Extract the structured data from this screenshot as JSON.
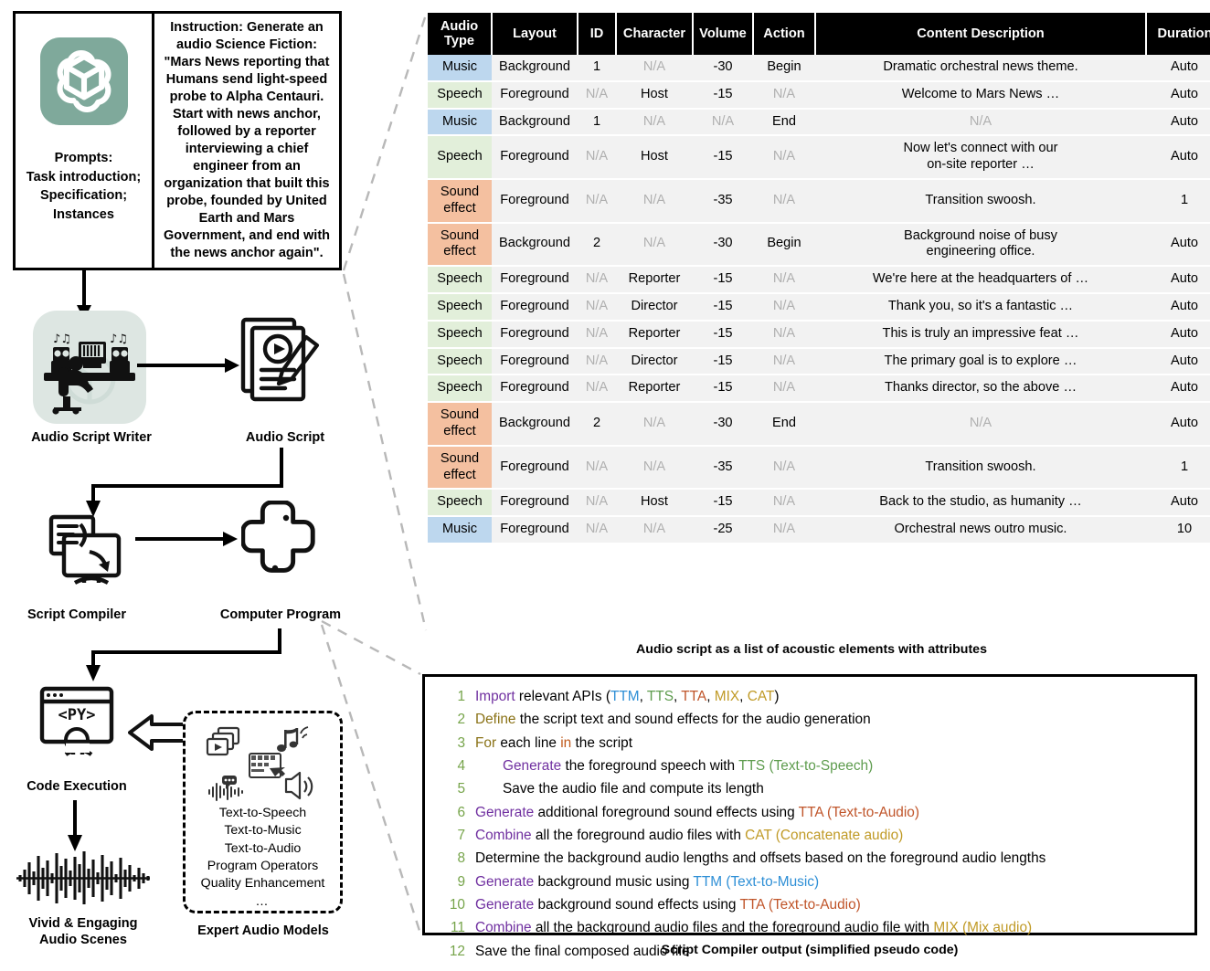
{
  "pipeline": {
    "prompts_label": "Prompts:\nTask introduction;\nSpecification;\nInstances",
    "instruction_text": "Instruction: Generate an audio Science Fiction: \"Mars News reporting that Humans send light-speed probe to Alpha Centauri. Start with news anchor, followed by a reporter interviewing a chief engineer from an organization that built this probe, founded by United Earth and Mars Government, and end with the news anchor again\".",
    "nodes": {
      "audio_script_writer": "Audio Script Writer",
      "audio_script": "Audio Script",
      "script_compiler": "Script Compiler",
      "computer_program": "Computer Program",
      "code_execution": "Code Execution",
      "vivid_scenes": "Vivid & Engaging\nAudio Scenes",
      "expert_audio_models": "Expert Audio Models"
    },
    "expert_models": [
      "Text-to-Speech",
      "Text-to-Music",
      "Text-to-Audio",
      "Program Operators",
      "Quality Enhancement",
      "…"
    ]
  },
  "table": {
    "caption": "Audio script as a list of  acoustic elements with attributes",
    "headers": [
      "Audio\nType",
      "Layout",
      "ID",
      "Character",
      "Volume",
      "Action",
      "Content Description",
      "Duration"
    ],
    "type_colors": {
      "Music": "#bdd7ee",
      "Speech": "#e2efda",
      "Sound effect": "#f4c0a0"
    },
    "rows": [
      {
        "type": "Music",
        "layout": "Background",
        "id": "1",
        "character": "N/A",
        "volume": "-30",
        "action": "Begin",
        "content": "Dramatic orchestral news theme.",
        "duration": "Auto"
      },
      {
        "type": "Speech",
        "layout": "Foreground",
        "id": "N/A",
        "character": "Host",
        "volume": "-15",
        "action": "N/A",
        "content": "Welcome to Mars News …",
        "duration": "Auto"
      },
      {
        "type": "Music",
        "layout": "Background",
        "id": "1",
        "character": "N/A",
        "volume": "N/A",
        "action": "End",
        "content": "N/A",
        "duration": "Auto"
      },
      {
        "type": "Speech",
        "layout": "Foreground",
        "id": "N/A",
        "character": "Host",
        "volume": "-15",
        "action": "N/A",
        "content": "Now let's connect with our\non-site reporter …",
        "duration": "Auto"
      },
      {
        "type": "Sound effect",
        "layout": "Foreground",
        "id": "N/A",
        "character": "N/A",
        "volume": "-35",
        "action": "N/A",
        "content": "Transition swoosh.",
        "duration": "1"
      },
      {
        "type": "Sound effect",
        "layout": "Background",
        "id": "2",
        "character": "N/A",
        "volume": "-30",
        "action": "Begin",
        "content": "Background noise of busy\nengineering office.",
        "duration": "Auto"
      },
      {
        "type": "Speech",
        "layout": "Foreground",
        "id": "N/A",
        "character": "Reporter",
        "volume": "-15",
        "action": "N/A",
        "content": "We're here at the headquarters of …",
        "duration": "Auto"
      },
      {
        "type": "Speech",
        "layout": "Foreground",
        "id": "N/A",
        "character": "Director",
        "volume": "-15",
        "action": "N/A",
        "content": "Thank you, so it's a fantastic …",
        "duration": "Auto"
      },
      {
        "type": "Speech",
        "layout": "Foreground",
        "id": "N/A",
        "character": "Reporter",
        "volume": "-15",
        "action": "N/A",
        "content": "This is truly an impressive feat …",
        "duration": "Auto"
      },
      {
        "type": "Speech",
        "layout": "Foreground",
        "id": "N/A",
        "character": "Director",
        "volume": "-15",
        "action": "N/A",
        "content": "The primary goal is to explore …",
        "duration": "Auto"
      },
      {
        "type": "Speech",
        "layout": "Foreground",
        "id": "N/A",
        "character": "Reporter",
        "volume": "-15",
        "action": "N/A",
        "content": "Thanks director, so the above …",
        "duration": "Auto"
      },
      {
        "type": "Sound effect",
        "layout": "Background",
        "id": "2",
        "character": "N/A",
        "volume": "-30",
        "action": "End",
        "content": "N/A",
        "duration": "Auto"
      },
      {
        "type": "Sound effect",
        "layout": "Foreground",
        "id": "N/A",
        "character": "N/A",
        "volume": "-35",
        "action": "N/A",
        "content": "Transition swoosh.",
        "duration": "1"
      },
      {
        "type": "Speech",
        "layout": "Foreground",
        "id": "N/A",
        "character": "Host",
        "volume": "-15",
        "action": "N/A",
        "content": "Back to the studio, as humanity …",
        "duration": "Auto"
      },
      {
        "type": "Music",
        "layout": "Foreground",
        "id": "N/A",
        "character": "N/A",
        "volume": "-25",
        "action": "N/A",
        "content": "Orchestral news outro music.",
        "duration": "10"
      }
    ]
  },
  "pseudocode": {
    "caption": "Script Compiler output (simplified pseudo code)",
    "lines": [
      {
        "n": "1",
        "indent": false,
        "tokens": [
          {
            "t": "Import",
            "c": "kw-purple"
          },
          {
            "t": " relevant APIs (",
            "c": ""
          },
          {
            "t": "TTM",
            "c": "api-ttm"
          },
          {
            "t": ", ",
            "c": ""
          },
          {
            "t": "TTS",
            "c": "api-tts"
          },
          {
            "t": ", ",
            "c": ""
          },
          {
            "t": "TTA",
            "c": "api-tta"
          },
          {
            "t": ", ",
            "c": ""
          },
          {
            "t": "MIX",
            "c": "api-mix"
          },
          {
            "t": ", ",
            "c": ""
          },
          {
            "t": "CAT",
            "c": "api-cat"
          },
          {
            "t": ")",
            "c": ""
          }
        ]
      },
      {
        "n": "2",
        "indent": false,
        "tokens": [
          {
            "t": "Define",
            "c": "kw-olive"
          },
          {
            "t": " the script text and sound effects for the audio generation",
            "c": ""
          }
        ]
      },
      {
        "n": "3",
        "indent": false,
        "tokens": [
          {
            "t": "For",
            "c": "kw-olive"
          },
          {
            "t": " each line ",
            "c": ""
          },
          {
            "t": "in",
            "c": "kw-orange"
          },
          {
            "t": " the script",
            "c": ""
          }
        ]
      },
      {
        "n": "4",
        "indent": true,
        "tokens": [
          {
            "t": "Generate",
            "c": "kw-purple"
          },
          {
            "t": " the foreground speech with ",
            "c": ""
          },
          {
            "t": "TTS (Text-to-Speech)",
            "c": "api-tts"
          }
        ]
      },
      {
        "n": "5",
        "indent": true,
        "tokens": [
          {
            "t": "Save the audio file and compute its length",
            "c": ""
          }
        ]
      },
      {
        "n": "6",
        "indent": false,
        "tokens": [
          {
            "t": "Generate",
            "c": "kw-purple"
          },
          {
            "t": " additional foreground sound effects using ",
            "c": ""
          },
          {
            "t": "TTA (Text-to-Audio)",
            "c": "api-tta"
          }
        ]
      },
      {
        "n": "7",
        "indent": false,
        "tokens": [
          {
            "t": "Combine",
            "c": "kw-purple"
          },
          {
            "t": " all the foreground audio files with ",
            "c": ""
          },
          {
            "t": "CAT (Concatenate audio)",
            "c": "api-cat"
          }
        ]
      },
      {
        "n": "8",
        "indent": false,
        "tokens": [
          {
            "t": "Determine the background audio lengths and offsets based on the foreground audio lengths",
            "c": ""
          }
        ]
      },
      {
        "n": "9",
        "indent": false,
        "tokens": [
          {
            "t": "Generate",
            "c": "kw-purple"
          },
          {
            "t": " background music using ",
            "c": ""
          },
          {
            "t": "TTM (Text-to-Music)",
            "c": "api-ttm"
          }
        ]
      },
      {
        "n": "10",
        "indent": false,
        "tokens": [
          {
            "t": "Generate",
            "c": "kw-purple"
          },
          {
            "t": " background sound effects using ",
            "c": ""
          },
          {
            "t": "TTA (Text-to-Audio)",
            "c": "api-tta"
          }
        ]
      },
      {
        "n": "11",
        "indent": false,
        "tokens": [
          {
            "t": "Combine",
            "c": "kw-purple"
          },
          {
            "t": " all the background audio files and the foreground audio file with ",
            "c": ""
          },
          {
            "t": "MIX (Mix audio)",
            "c": "api-mix"
          }
        ]
      },
      {
        "n": "12",
        "indent": false,
        "tokens": [
          {
            "t": "Save the final composed audio file",
            "c": ""
          }
        ]
      }
    ]
  }
}
